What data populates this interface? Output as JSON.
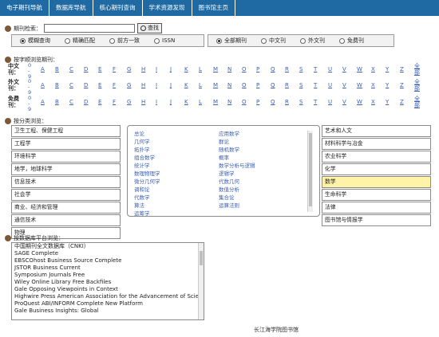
{
  "nav": {
    "items": [
      "电子期刊导航",
      "数据库导航",
      "核心期刊查询",
      "学术资源发现",
      "图书馆主页"
    ]
  },
  "search": {
    "label": "期刊检索：",
    "value": "",
    "button_label": "查找",
    "match_options": [
      {
        "label": "模糊查询",
        "selected": true
      },
      {
        "label": "精确匹配",
        "selected": false
      },
      {
        "label": "前方一致",
        "selected": false
      },
      {
        "label": "ISSN",
        "selected": false
      }
    ],
    "lang_options": [
      {
        "label": "全部期刊",
        "selected": true
      },
      {
        "label": "中文刊",
        "selected": false
      },
      {
        "label": "外文刊",
        "selected": false
      },
      {
        "label": "免费刊",
        "selected": false
      }
    ]
  },
  "alpha": {
    "title": "按字顺浏览期刊：",
    "digits": [
      "0",
      "-",
      "9"
    ],
    "letters": [
      "A",
      "B",
      "C",
      "D",
      "E",
      "F",
      "G",
      "H",
      "I",
      "J",
      "K",
      "L",
      "M",
      "N",
      "O",
      "P",
      "Q",
      "R",
      "S",
      "T",
      "U",
      "V",
      "W",
      "X",
      "Y",
      "Z"
    ],
    "all_label": [
      "全",
      "部"
    ],
    "rows": [
      {
        "label": [
          "中文",
          "刊："
        ]
      },
      {
        "label": [
          "外文",
          "刊："
        ]
      },
      {
        "label": [
          "免费",
          "刊："
        ]
      }
    ]
  },
  "categories": {
    "title": "按分类浏览：",
    "left": [
      "卫生工程、保健工程",
      "工程学",
      "环境科学",
      "地学，地球科学",
      "信息技术",
      "社会学",
      "商业、经济和管理",
      "通信技术",
      "物理"
    ],
    "right": [
      "艺术和人文",
      "材料科学与冶金",
      "农业科学",
      "化学",
      "数学",
      "生命科学",
      "法律",
      "图书馆与情报学"
    ],
    "active_right": "数学",
    "sub_left": [
      "总论",
      "几何学",
      "拓扑学",
      "组合数学",
      "统计学",
      "数理物理学",
      "微分几何学",
      "调和论",
      "代数学",
      "算法",
      "运筹学"
    ],
    "sub_right": [
      "应用数学",
      "群论",
      "随机数学",
      "概率",
      "数学分析与逻辑",
      "逻辑学",
      "代数几何",
      "数值分析",
      "集合论",
      "运算法则"
    ]
  },
  "databases": {
    "title": "按数据库平台浏览：",
    "items": [
      "中国期刊全文数据库（CNKI）",
      "SAGE Complete",
      "EBSCOhost Business Source Complete",
      "JSTOR Business Current",
      "Symposium Journals Free",
      "Wiley Online Library Free Backfiles",
      "Gale Opposing Viewpoints in Context",
      "Highwire Press American Association for the Advancement of Science",
      "ProQuest ABI/INFORM Complete New Platform",
      "Gale Business Insights: Global"
    ]
  },
  "footer": {
    "text": "长江海学院图书馆"
  }
}
